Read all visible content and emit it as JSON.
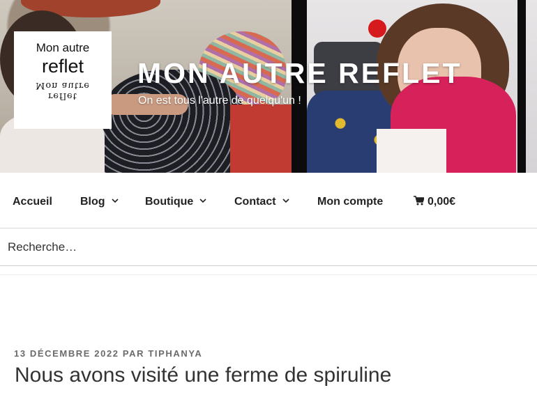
{
  "site": {
    "logo_line1": "Mon autre",
    "logo_line2": "reflet",
    "logo_mirror_line1": "reflet",
    "logo_mirror_line2": "Mon autre",
    "title": "MON AUTRE REFLET",
    "description": "On est tous l'autre de quelqu'un !"
  },
  "nav": {
    "items": [
      {
        "label": "Accueil",
        "has_submenu": false
      },
      {
        "label": "Blog",
        "has_submenu": true
      },
      {
        "label": "Boutique",
        "has_submenu": true
      },
      {
        "label": "Contact",
        "has_submenu": true
      },
      {
        "label": "Mon compte",
        "has_submenu": false
      }
    ],
    "cart": {
      "icon": "cart-icon",
      "amount": "0,00€"
    }
  },
  "search": {
    "placeholder": "Recherche…"
  },
  "post": {
    "date": "13 DÉCEMBRE 2022",
    "by": "PAR",
    "author": "TIPHANYA",
    "title": "Nous avons visité une ferme de spiruline"
  },
  "colors": {
    "nav_text": "#222222",
    "meta_text": "#6b6b6b",
    "title_text": "#333333"
  }
}
